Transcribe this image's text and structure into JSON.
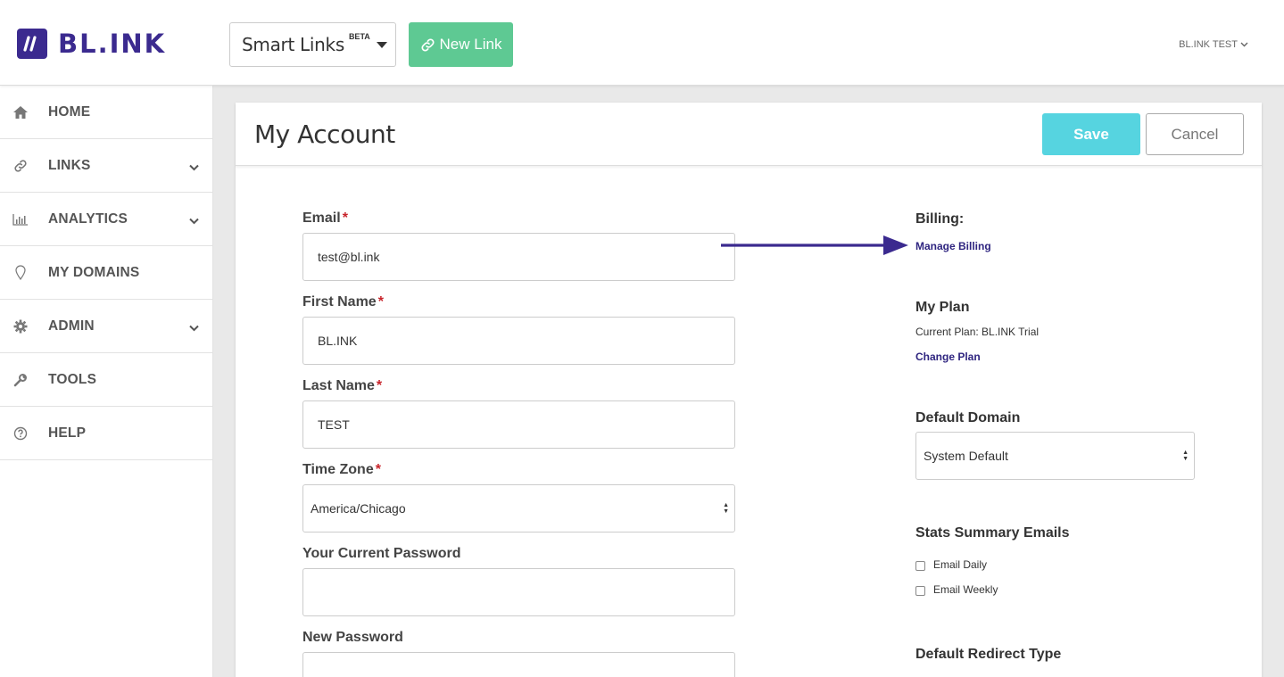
{
  "header": {
    "logo_text": "BL.INK",
    "smart_links_label": "Smart Links",
    "beta_badge": "BETA",
    "new_link_label": "New Link",
    "user_menu_label": "BL.INK TEST"
  },
  "sidebar": {
    "items": [
      {
        "label": "HOME",
        "icon": "home-icon"
      },
      {
        "label": "LINKS",
        "icon": "link-icon"
      },
      {
        "label": "ANALYTICS",
        "icon": "bar-chart-icon"
      },
      {
        "label": "MY DOMAINS",
        "icon": "map-pin-icon"
      },
      {
        "label": "ADMIN",
        "icon": "gear-icon"
      },
      {
        "label": "TOOLS",
        "icon": "wrench-icon"
      },
      {
        "label": "HELP",
        "icon": "question-circle-icon"
      }
    ]
  },
  "page": {
    "title": "My Account",
    "save_label": "Save",
    "cancel_label": "Cancel"
  },
  "form": {
    "email": {
      "label": "Email",
      "value": "test@bl.ink"
    },
    "first_name": {
      "label": "First Name",
      "value": "BL.INK"
    },
    "last_name": {
      "label": "Last Name",
      "value": "TEST"
    },
    "time_zone": {
      "label": "Time Zone",
      "value": "America/Chicago"
    },
    "current_password": {
      "label": "Your Current Password",
      "value": ""
    },
    "new_password": {
      "label": "New Password",
      "value": ""
    },
    "required_mark": "*"
  },
  "right": {
    "billing_heading": "Billing:",
    "manage_billing_link": "Manage Billing",
    "plan_heading": "My Plan",
    "current_plan_text": "Current Plan: BL.INK Trial",
    "change_plan_link": "Change Plan",
    "default_domain_heading": "Default Domain",
    "default_domain_value": "System Default",
    "stats_heading": "Stats Summary Emails",
    "email_daily_label": "Email Daily",
    "email_weekly_label": "Email Weekly",
    "redirect_heading": "Default Redirect Type"
  },
  "colors": {
    "brand": "#3b2a8f",
    "new_link_green": "#5ec993",
    "save_cyan": "#56d4e0",
    "required_red": "#c8242b",
    "link_purple": "#2f2580"
  }
}
